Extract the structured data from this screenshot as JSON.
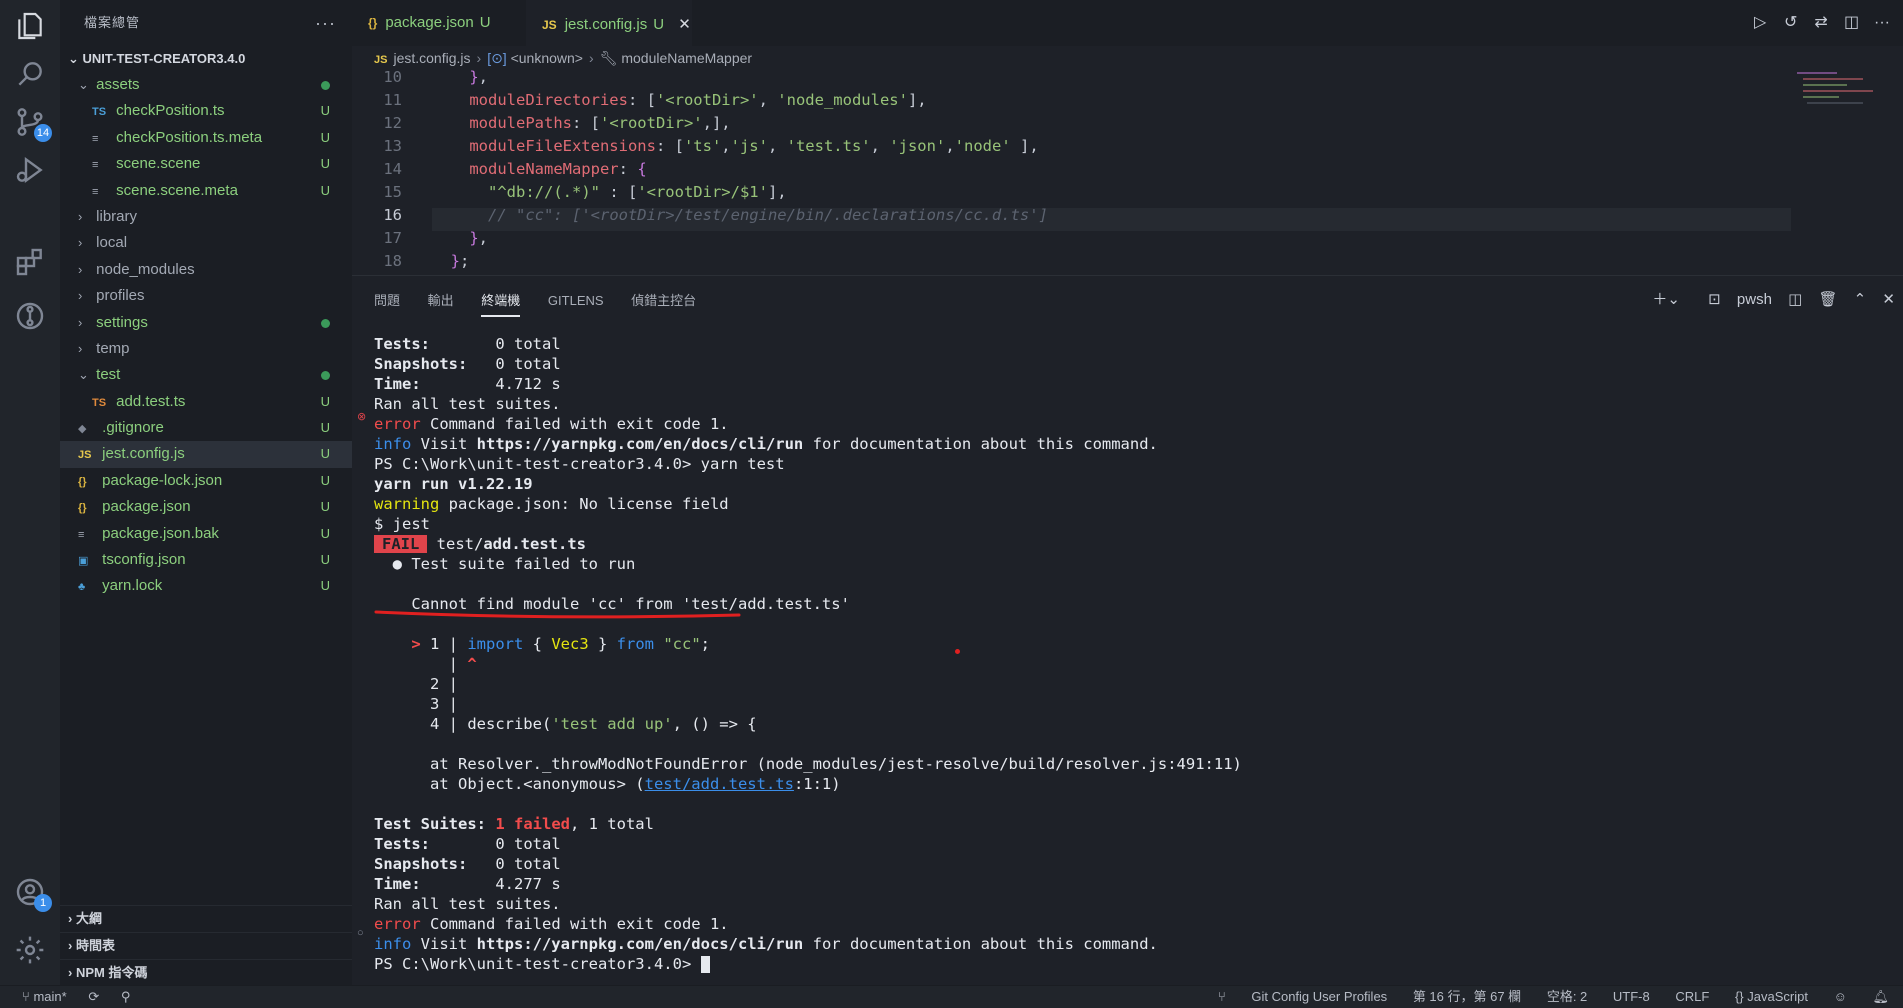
{
  "sidebar": {
    "title": "檔案總管",
    "root": "UNIT-TEST-CREATOR3.4.0",
    "items": [
      {
        "label": "assets",
        "kind": "folder-open",
        "depth": 1,
        "status": "dot",
        "cls": "c-green"
      },
      {
        "label": "checkPosition.ts",
        "kind": "TS",
        "depth": 2,
        "status": "U",
        "cls": "c-green"
      },
      {
        "label": "checkPosition.ts.meta",
        "kind": "lines",
        "depth": 2,
        "status": "U",
        "cls": "c-green"
      },
      {
        "label": "scene.scene",
        "kind": "lines",
        "depth": 2,
        "status": "U",
        "cls": "c-green"
      },
      {
        "label": "scene.scene.meta",
        "kind": "lines",
        "depth": 2,
        "status": "U",
        "cls": "c-green"
      },
      {
        "label": "library",
        "kind": "folder",
        "depth": 1,
        "status": "",
        "cls": "c-gray"
      },
      {
        "label": "local",
        "kind": "folder",
        "depth": 1,
        "status": "",
        "cls": "c-gray"
      },
      {
        "label": "node_modules",
        "kind": "folder",
        "depth": 1,
        "status": "",
        "cls": "c-gray"
      },
      {
        "label": "profiles",
        "kind": "folder",
        "depth": 1,
        "status": "",
        "cls": "c-gray"
      },
      {
        "label": "settings",
        "kind": "folder",
        "depth": 1,
        "status": "dot",
        "cls": "c-green"
      },
      {
        "label": "temp",
        "kind": "folder",
        "depth": 1,
        "status": "",
        "cls": "c-gray"
      },
      {
        "label": "test",
        "kind": "folder-open",
        "depth": 1,
        "status": "dot",
        "cls": "c-green"
      },
      {
        "label": "add.test.ts",
        "kind": "TS-err",
        "depth": 2,
        "status": "U",
        "cls": "c-green"
      },
      {
        "label": ".gitignore",
        "kind": "git",
        "depth": 1,
        "status": "U",
        "cls": "c-green"
      },
      {
        "label": "jest.config.js",
        "kind": "JS",
        "depth": 1,
        "status": "U",
        "cls": "c-green",
        "selected": true
      },
      {
        "label": "package-lock.json",
        "kind": "{}",
        "depth": 1,
        "status": "U",
        "cls": "c-green"
      },
      {
        "label": "package.json",
        "kind": "{}",
        "depth": 1,
        "status": "U",
        "cls": "c-green"
      },
      {
        "label": "package.json.bak",
        "kind": "lines",
        "depth": 1,
        "status": "U",
        "cls": "c-green"
      },
      {
        "label": "tsconfig.json",
        "kind": "ts-cfg",
        "depth": 1,
        "status": "U",
        "cls": "c-green"
      },
      {
        "label": "yarn.lock",
        "kind": "yarn",
        "depth": 1,
        "status": "U",
        "cls": "c-green"
      }
    ],
    "bottom": [
      "大綱",
      "時間表",
      "NPM 指令碼"
    ]
  },
  "activity": {
    "scm_badge": "14",
    "account_badge": "1"
  },
  "tabs": [
    {
      "icon": "{}",
      "label": "package.json",
      "status": "U",
      "active": false
    },
    {
      "icon": "JS",
      "label": "jest.config.js",
      "status": "U",
      "active": true
    }
  ],
  "breadcrumb": [
    "jest.config.js",
    "<unknown>",
    "moduleNameMapper"
  ],
  "editor": {
    "lines": [
      {
        "n": "10",
        "html": "    <span class='k-brk'>}</span>,"
      },
      {
        "n": "11",
        "html": "    <span class='k-prop'>moduleDirectories</span>: [<span class='k-str'>'&lt;rootDir&gt;'</span>, <span class='k-str'>'node_modules'</span>],"
      },
      {
        "n": "12",
        "html": "    <span class='k-prop'>modulePaths</span>: [<span class='k-str'>'&lt;rootDir&gt;'</span>,],"
      },
      {
        "n": "13",
        "html": "    <span class='k-prop'>moduleFileExtensions</span>: [<span class='k-str'>'ts'</span>,<span class='k-str'>'js'</span>, <span class='k-str'>'test.ts'</span>, <span class='k-str'>'json'</span>,<span class='k-str'>'node'</span> ],"
      },
      {
        "n": "14",
        "html": "    <span class='k-prop'>moduleNameMapper</span>: <span class='k-brk'>{</span>"
      },
      {
        "n": "15",
        "html": "      <span class='k-str'>\"^db://(.*)\"</span> : [<span class='k-str'>'&lt;rootDir&gt;/$1'</span>],"
      },
      {
        "n": "16",
        "html": "      <span class='k-cm'>// \"cc\": ['&lt;rootDir&gt;/test/engine/bin/.declarations/cc.d.ts']</span>",
        "current": true
      },
      {
        "n": "17",
        "html": "    <span class='k-brk'>}</span>,"
      },
      {
        "n": "18",
        "html": "  <span class='k-brk'>}</span>;"
      }
    ]
  },
  "panel": {
    "tabs": [
      "問題",
      "輸出",
      "終端機",
      "GITLENS",
      "偵錯主控台"
    ],
    "active_tab": "終端機",
    "shell": "pwsh"
  },
  "terminal": [
    "<span class='b'>Tests:</span>       0 total",
    "<span class='b'>Snapshots:</span>   0 total",
    "<span class='b'>Time:</span>        4.712 s",
    "Ran all test suites.",
    "<span class='t-red'>error</span> Command failed with exit code 1.",
    "<span class='t-blue'>info</span> Visit <span class='b'>https://yarnpkg.com/en/docs/cli/run</span> for documentation about this command.",
    "PS C:\\Work\\unit-test-creator3.4.0&gt; yarn test",
    "<span class='b'>yarn run v1.22.19</span>",
    "<span class='t-yel'>warning</span> package.json: No license field",
    "$ jest",
    "<span class='fail'>FAIL</span> test/<span class='b'>add.test.ts</span>",
    "  <span class='b'>●</span> Test suite failed to run",
    "",
    "    Cannot find module 'cc' from 'test/add.test.ts'",
    "",
    "    <span class='t-red b'>&gt;</span> 1 | <span class='t-blue'>import</span> { <span class='t-yel'>Vec3</span> } <span class='t-blue'>from</span> <span class='k-str'>\"cc\"</span>;",
    "        | <span class='t-red b'>^</span>",
    "      2 |",
    "      3 |",
    "      4 | describe(<span class='k-str'>'test add up'</span>, () =&gt; {",
    "",
    "      at Resolver._throwModNotFoundError (node_modules/jest-resolve/build/resolver.js:491:11)",
    "      at Object.&lt;anonymous&gt; (<span class='t-link'>test/add.test.ts</span>:1:1)",
    "",
    "<span class='b'>Test Suites:</span> <span class='t-red b'>1 failed</span>, 1 total",
    "<span class='b'>Tests:</span>       0 total",
    "<span class='b'>Snapshots:</span>   0 total",
    "<span class='b'>Time:</span>        4.277 s",
    "Ran all test suites.",
    "<span class='t-red'>error</span> Command failed with exit code 1.",
    "<span class='t-blue'>info</span> Visit <span class='b'>https://yarnpkg.com/en/docs/cli/run</span> for documentation about this command.",
    "PS C:\\Work\\unit-test-creator3.4.0&gt; <span class='cursor-block'></span>"
  ],
  "status": {
    "branch": "main*",
    "right": [
      "Git Config User Profiles",
      "第 16 行，第 67 欄",
      "空格: 2",
      "UTF-8",
      "CRLF",
      "{} JavaScript"
    ]
  },
  "colors": {
    "accent": "#3b8eea",
    "error": "#e0444b",
    "annotation": "#e02020"
  }
}
